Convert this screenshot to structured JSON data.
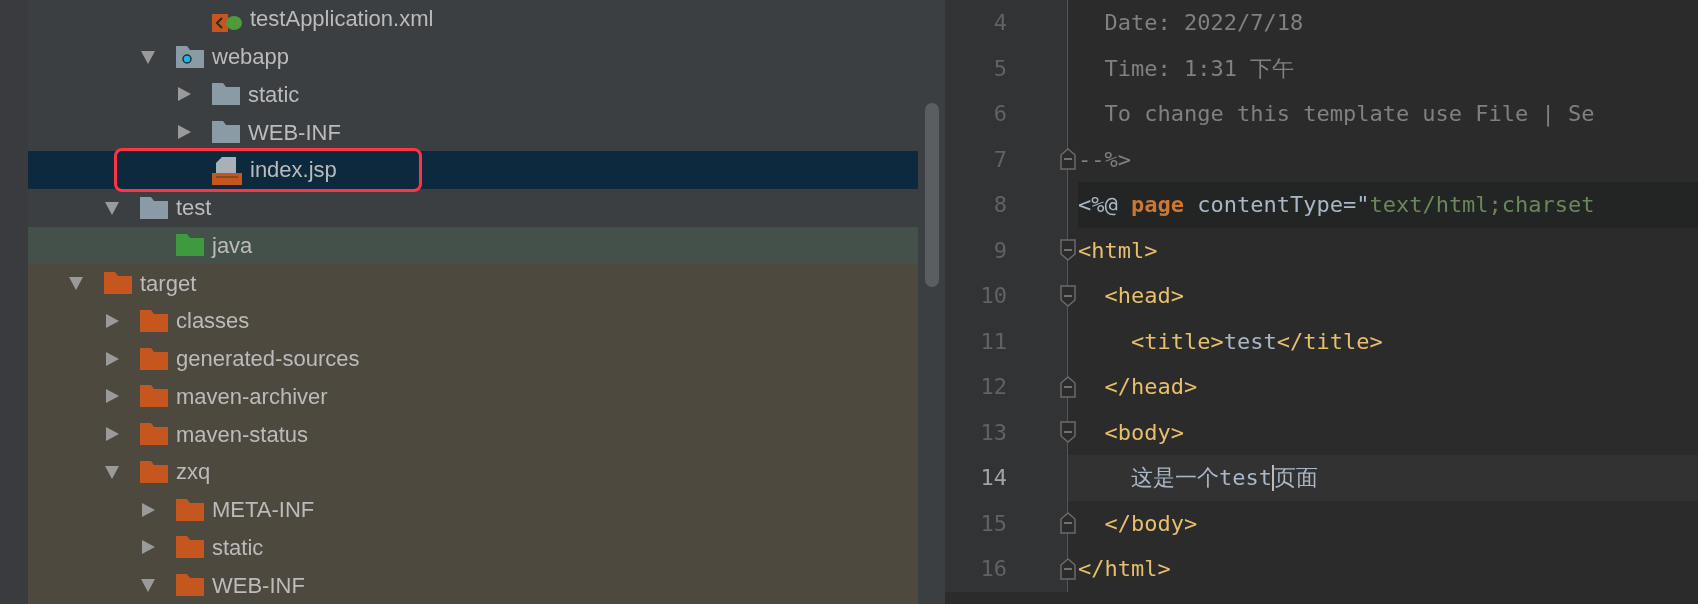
{
  "project_tree": [
    {
      "children": [
        {
          "children": [
            {
              "children": [
                {
                  "label": "testApplication.xml",
                  "kind": "xml-file",
                  "selected": false,
                  "highlighted": false
                }
              ]
            },
            {
              "label": "webapp",
              "kind": "web-folder",
              "expanded": true,
              "selected": false,
              "highlighted": false,
              "children": [
                {
                  "label": "static",
                  "kind": "folder",
                  "expanded": false,
                  "selected": false,
                  "highlighted": false
                },
                {
                  "label": "WEB-INF",
                  "kind": "folder",
                  "expanded": false,
                  "selected": false,
                  "highlighted": false
                },
                {
                  "label": "index.jsp",
                  "kind": "jsp-file",
                  "selected": true,
                  "highlighted": true
                }
              ]
            }
          ]
        },
        {
          "label": "test",
          "kind": "folder",
          "expanded": true,
          "selected": false,
          "highlighted": false,
          "children": [
            {
              "label": "java",
              "kind": "test-folder",
              "selected": false,
              "highlighted": false
            }
          ]
        }
      ]
    },
    {
      "label": "target",
      "kind": "excluded-folder",
      "expanded": true,
      "selected": false,
      "highlighted": false,
      "children": [
        {
          "label": "classes",
          "kind": "excluded-folder",
          "expanded": false,
          "selected": false,
          "highlighted": false
        },
        {
          "label": "generated-sources",
          "kind": "excluded-folder",
          "expanded": false,
          "selected": false,
          "highlighted": false
        },
        {
          "label": "maven-archiver",
          "kind": "excluded-folder",
          "expanded": false,
          "selected": false,
          "highlighted": false
        },
        {
          "label": "maven-status",
          "kind": "excluded-folder",
          "expanded": false,
          "selected": false,
          "highlighted": false
        },
        {
          "label": "zxq",
          "kind": "excluded-folder",
          "expanded": true,
          "selected": false,
          "highlighted": false,
          "children": [
            {
              "label": "META-INF",
              "kind": "excluded-folder",
              "expanded": false,
              "selected": false,
              "highlighted": false
            },
            {
              "label": "static",
              "kind": "excluded-folder",
              "expanded": false,
              "selected": false,
              "highlighted": false
            },
            {
              "label": "WEB-INF",
              "kind": "excluded-folder",
              "expanded": true,
              "selected": false,
              "highlighted": false
            }
          ]
        }
      ]
    }
  ],
  "editor": {
    "lines": [
      {
        "number": "4",
        "kind": "code",
        "current": false,
        "tokens": [
          {
            "kind": "comment",
            "text": "  Date: 2022/7/18"
          }
        ]
      },
      {
        "number": "5",
        "kind": "code",
        "current": false,
        "tokens": [
          {
            "kind": "comment",
            "text": "  Time: 1:31 下午"
          }
        ]
      },
      {
        "number": "6",
        "kind": "code",
        "current": false,
        "tokens": [
          {
            "kind": "comment",
            "text": "  To change this template use File | Se"
          }
        ]
      },
      {
        "number": "7",
        "kind": "code",
        "current": false,
        "fold_marker": true,
        "fold_opens": false,
        "tokens": [
          {
            "kind": "comment",
            "text": "--%>"
          }
        ]
      },
      {
        "number": "8",
        "kind": "directive",
        "current": false,
        "tokens": [
          {
            "kind": "plain",
            "text": "<%@ "
          },
          {
            "kind": "keyword",
            "text": "page"
          },
          {
            "kind": "plain",
            "text": " contentType=\""
          },
          {
            "kind": "string",
            "text": "text/html;charset"
          }
        ]
      },
      {
        "number": "9",
        "kind": "code",
        "current": false,
        "fold_marker": true,
        "fold_opens": true,
        "tokens": [
          {
            "kind": "tag",
            "text": "<html>"
          }
        ]
      },
      {
        "number": "10",
        "kind": "code",
        "current": false,
        "fold_marker": true,
        "fold_opens": true,
        "tokens": [
          {
            "kind": "tag",
            "text": "  <head>"
          }
        ]
      },
      {
        "number": "11",
        "kind": "code",
        "current": false,
        "tokens": [
          {
            "kind": "tag",
            "text": "    <title>"
          },
          {
            "kind": "plain",
            "text": "test"
          },
          {
            "kind": "tag",
            "text": "</title>"
          }
        ]
      },
      {
        "number": "12",
        "kind": "code",
        "current": false,
        "fold_marker": true,
        "fold_opens": false,
        "tokens": [
          {
            "kind": "tag",
            "text": "  </head>"
          }
        ]
      },
      {
        "number": "13",
        "kind": "code",
        "current": false,
        "fold_marker": true,
        "fold_opens": true,
        "tokens": [
          {
            "kind": "tag",
            "text": "  <body>"
          }
        ]
      },
      {
        "number": "14",
        "kind": "code",
        "current": true,
        "tokens": [
          {
            "kind": "plain",
            "text": "    这是一个test"
          },
          {
            "kind": "caret"
          },
          {
            "kind": "plain",
            "text": "页面"
          }
        ]
      },
      {
        "number": "15",
        "kind": "code",
        "current": false,
        "fold_marker": true,
        "fold_opens": false,
        "tokens": [
          {
            "kind": "tag",
            "text": "  </body>"
          }
        ]
      },
      {
        "number": "16",
        "kind": "code",
        "current": false,
        "fold_marker": true,
        "fold_opens": false,
        "tokens": [
          {
            "kind": "tag",
            "text": "</html>"
          }
        ]
      }
    ]
  }
}
